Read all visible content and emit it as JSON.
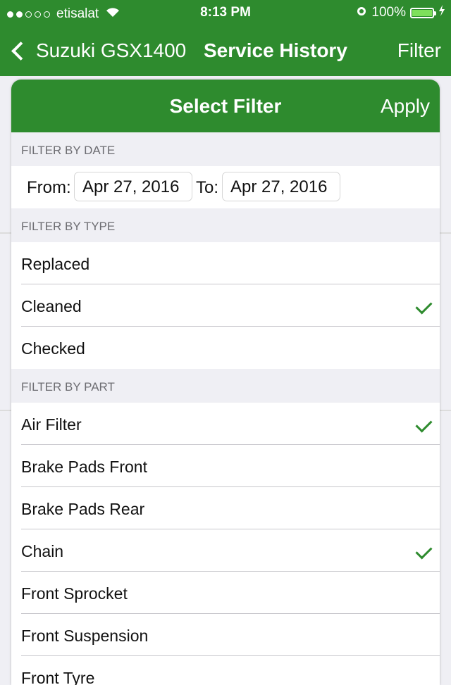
{
  "status_bar": {
    "carrier": "etisalat",
    "time": "8:13 PM",
    "battery_percent": "100%",
    "battery_level": 1.0
  },
  "nav": {
    "back_label": "Suzuki GSX1400",
    "title": "Service History",
    "filter_label": "Filter"
  },
  "modal": {
    "title": "Select Filter",
    "apply_label": "Apply",
    "date_section": {
      "header": "FILTER BY DATE",
      "from_label": "From:",
      "from_value": "Apr 27, 2016",
      "to_label": "To:",
      "to_value": "Apr 27, 2016"
    },
    "type_section": {
      "header": "FILTER BY TYPE",
      "items": [
        {
          "label": "Replaced",
          "checked": false
        },
        {
          "label": "Cleaned",
          "checked": true
        },
        {
          "label": "Checked",
          "checked": false
        }
      ]
    },
    "part_section": {
      "header": "FILTER BY PART",
      "items": [
        {
          "label": "Air Filter",
          "checked": true
        },
        {
          "label": "Brake Pads Front",
          "checked": false
        },
        {
          "label": "Brake Pads Rear",
          "checked": false
        },
        {
          "label": "Chain",
          "checked": true
        },
        {
          "label": "Front Sprocket",
          "checked": false
        },
        {
          "label": "Front Suspension",
          "checked": false
        },
        {
          "label": "Front Tyre",
          "checked": false
        }
      ]
    }
  },
  "colors": {
    "brand_green": "#2e8b2e",
    "battery_green": "#7ee05b"
  }
}
